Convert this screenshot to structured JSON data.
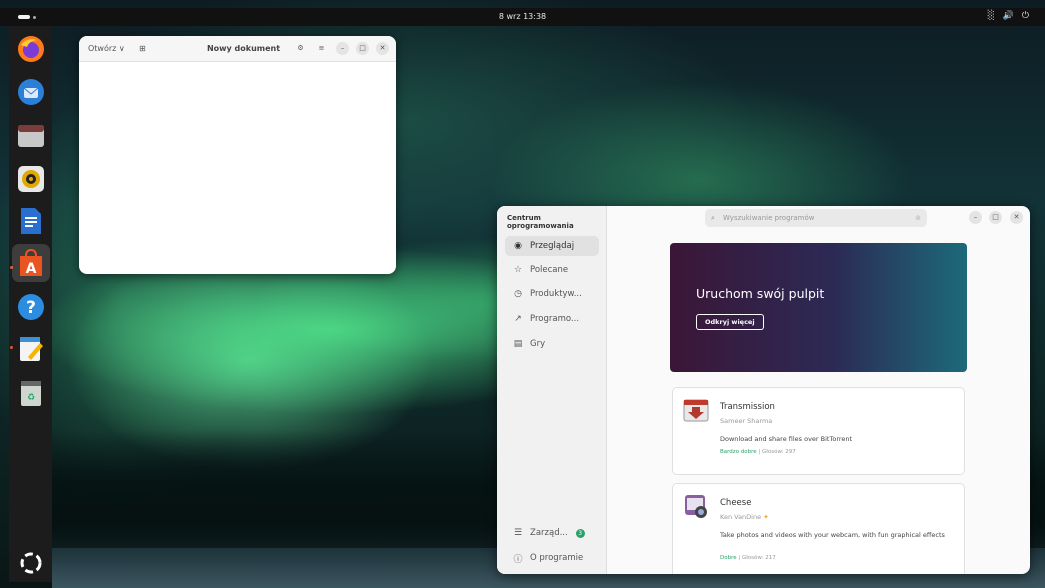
{
  "topbar": {
    "clock": "8 wrz  13:38"
  },
  "dock": {
    "items": [
      "firefox-icon",
      "thunderbird-icon",
      "files-icon",
      "rhythmbox-icon",
      "writer-icon",
      "software-icon",
      "help-icon",
      "text-editor-icon",
      "trash-icon"
    ],
    "show_apps": "show-apps-icon"
  },
  "editor": {
    "open_label": "Otwórz",
    "title": "Nowy dokument"
  },
  "software_center": {
    "app_title": "Centrum oprogramowania",
    "search_placeholder": "Wyszukiwanie programów",
    "nav": [
      {
        "label": "Przeglądaj"
      },
      {
        "label": "Polecane"
      },
      {
        "label": "Produktyw..."
      },
      {
        "label": "Programo..."
      },
      {
        "label": "Gry"
      }
    ],
    "manage_label": "Zarząd...",
    "manage_badge": "3",
    "about_label": "O programie",
    "banner": {
      "title": "Uruchom swój pulpit",
      "button": "Odkryj więcej",
      "colors": [
        "#3b1637",
        "#2c2a55",
        "#1c6a7a"
      ]
    },
    "apps": [
      {
        "name": "Transmission",
        "author": "Sameer Sharma",
        "description": "Download and share files over BitTorrent",
        "rating": "Bardzo dobre",
        "votes": "| Głosów: 297"
      },
      {
        "name": "Cheese",
        "author": "Ken VanDine",
        "description": "Take photos and videos with your webcam, with fun graphical effects",
        "rating": "Dobre",
        "votes": "| Głosów: 217"
      }
    ]
  }
}
